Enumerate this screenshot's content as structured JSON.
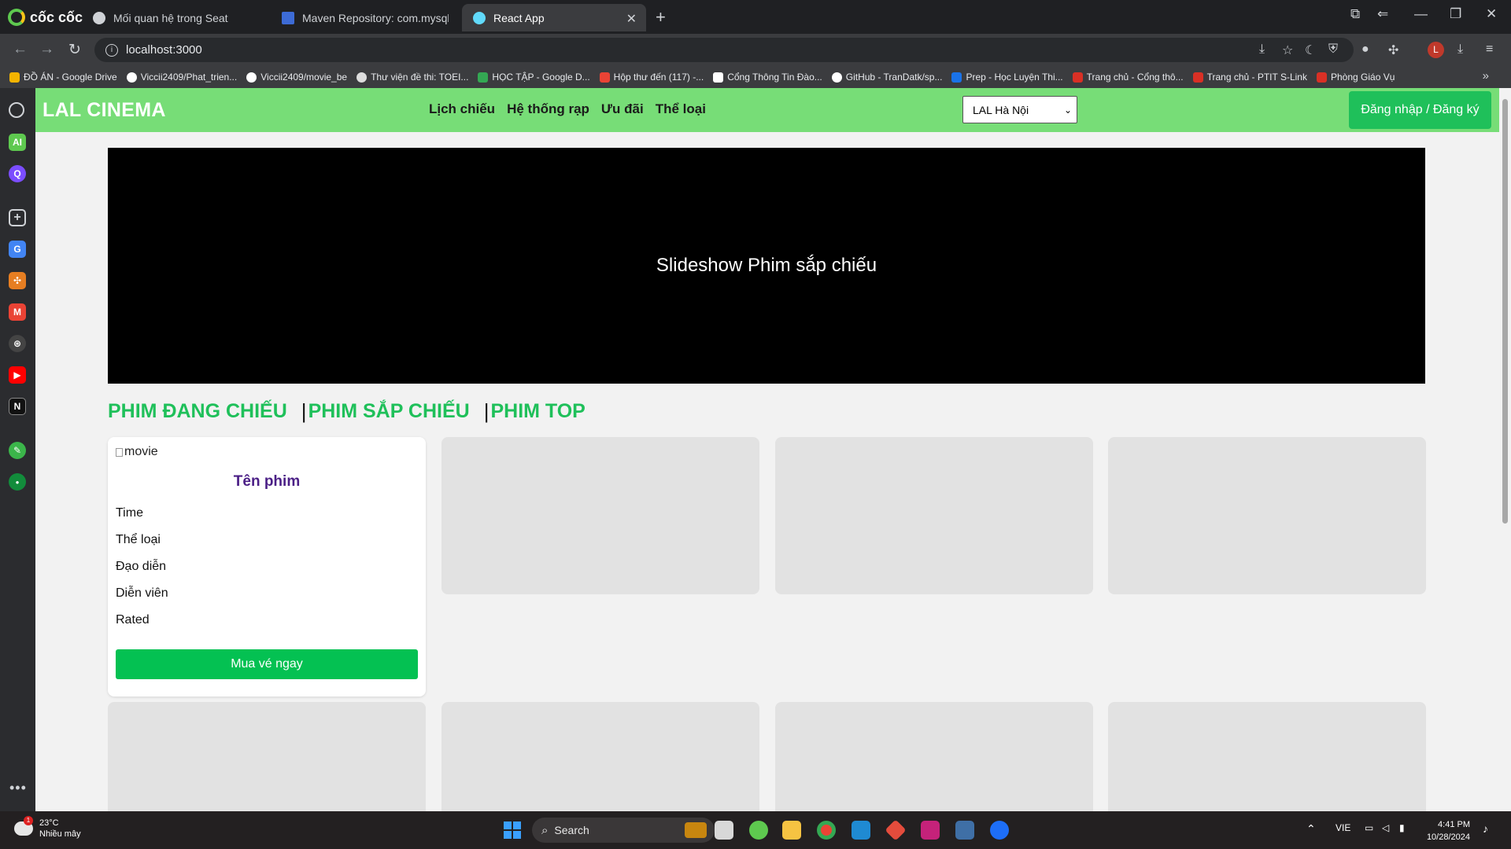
{
  "browser": {
    "brand": "cốc cốc",
    "tabs": [
      {
        "title": "Mối quan hệ trong Seat",
        "active": false
      },
      {
        "title": "Maven Repository: com.mysql » m",
        "active": false
      },
      {
        "title": "React App",
        "active": true
      }
    ],
    "address": "localhost:3000",
    "profile_initial": "L",
    "bookmarks": [
      "ĐỒ ÁN - Google Drive",
      "Viccii2409/Phat_trien...",
      "Viccii2409/movie_be",
      "Thư viện đề thi: TOEI...",
      "HỌC TẬP - Google D...",
      "Hộp thư đến (117) -...",
      "Cổng Thông Tin Đào...",
      "GitHub - TranDatk/sp...",
      "Prep - Học Luyện Thi...",
      "Trang chủ - Cổng thô...",
      "Trang chủ - PTIT S-Link",
      "Phòng Giáo Vụ"
    ]
  },
  "app": {
    "logo": "LAL CINEMA",
    "nav": [
      "Lịch chiếu",
      "Hệ thống rạp",
      "Ưu đãi",
      "Thể loại"
    ],
    "city_select": {
      "selected": "LAL Hà Nội"
    },
    "login_button": "Đăng nhập / Đăng ký",
    "hero_text": "Slideshow Phim sắp chiếu",
    "section_tabs": [
      "PHIM ĐANG CHIẾU",
      "PHIM SẮP CHIẾU",
      "PHIM TOP"
    ],
    "section_separator": "|",
    "movie_card": {
      "image_alt": "movie",
      "title": "Tên phim",
      "fields": [
        "Time",
        "Thể loại",
        "Đạo diễn",
        "Diễn viên",
        "Rated"
      ],
      "buy_button": "Mua vé ngay"
    },
    "accent_color": "#77dd77",
    "primary_color": "#1fc05a"
  },
  "taskbar": {
    "weather_temp": "23°C",
    "weather_desc": "Nhiều mây",
    "weather_alert": "1",
    "search_label": "Search",
    "language": "VIE",
    "time": "4:41 PM",
    "date": "10/28/2024"
  }
}
